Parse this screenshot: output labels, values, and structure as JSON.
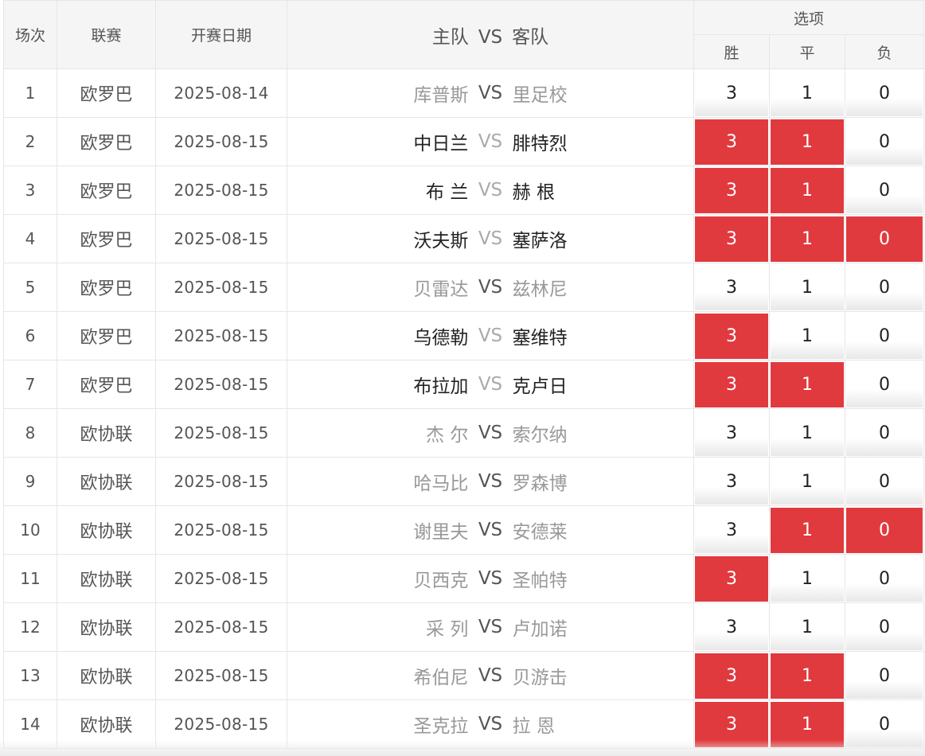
{
  "headers": {
    "num": "场次",
    "league": "联赛",
    "date": "开赛日期",
    "home": "主队",
    "vs": "VS",
    "away": "客队",
    "options": "选项",
    "win": "胜",
    "draw": "平",
    "loss": "负"
  },
  "colors": {
    "selected": "#e03a3e",
    "active_team": "#222222",
    "inactive_team": "#999999"
  },
  "matches": [
    {
      "num": "1",
      "league": "欧罗巴",
      "date": "2025-08-14",
      "home": "库普斯",
      "away": "里足校",
      "active": false,
      "w": "3",
      "d": "1",
      "l": "0",
      "sel": [
        false,
        false,
        false
      ]
    },
    {
      "num": "2",
      "league": "欧罗巴",
      "date": "2025-08-15",
      "home": "中日兰",
      "away": "腓特烈",
      "active": true,
      "w": "3",
      "d": "1",
      "l": "0",
      "sel": [
        true,
        true,
        false
      ]
    },
    {
      "num": "3",
      "league": "欧罗巴",
      "date": "2025-08-15",
      "home": "布 兰",
      "away": "赫 根",
      "active": true,
      "w": "3",
      "d": "1",
      "l": "0",
      "sel": [
        true,
        true,
        false
      ]
    },
    {
      "num": "4",
      "league": "欧罗巴",
      "date": "2025-08-15",
      "home": "沃夫斯",
      "away": "塞萨洛",
      "active": true,
      "w": "3",
      "d": "1",
      "l": "0",
      "sel": [
        true,
        true,
        true
      ]
    },
    {
      "num": "5",
      "league": "欧罗巴",
      "date": "2025-08-15",
      "home": "贝雷达",
      "away": "兹林尼",
      "active": false,
      "w": "3",
      "d": "1",
      "l": "0",
      "sel": [
        false,
        false,
        false
      ]
    },
    {
      "num": "6",
      "league": "欧罗巴",
      "date": "2025-08-15",
      "home": "乌德勒",
      "away": "塞维特",
      "active": true,
      "w": "3",
      "d": "1",
      "l": "0",
      "sel": [
        true,
        false,
        false
      ]
    },
    {
      "num": "7",
      "league": "欧罗巴",
      "date": "2025-08-15",
      "home": "布拉加",
      "away": "克卢日",
      "active": true,
      "w": "3",
      "d": "1",
      "l": "0",
      "sel": [
        true,
        true,
        false
      ]
    },
    {
      "num": "8",
      "league": "欧协联",
      "date": "2025-08-15",
      "home": "杰 尔",
      "away": "索尔纳",
      "active": false,
      "w": "3",
      "d": "1",
      "l": "0",
      "sel": [
        false,
        false,
        false
      ]
    },
    {
      "num": "9",
      "league": "欧协联",
      "date": "2025-08-15",
      "home": "哈马比",
      "away": "罗森博",
      "active": false,
      "w": "3",
      "d": "1",
      "l": "0",
      "sel": [
        false,
        false,
        false
      ]
    },
    {
      "num": "10",
      "league": "欧协联",
      "date": "2025-08-15",
      "home": "谢里夫",
      "away": "安德莱",
      "active": false,
      "w": "3",
      "d": "1",
      "l": "0",
      "sel": [
        false,
        true,
        true
      ]
    },
    {
      "num": "11",
      "league": "欧协联",
      "date": "2025-08-15",
      "home": "贝西克",
      "away": "圣帕特",
      "active": false,
      "w": "3",
      "d": "1",
      "l": "0",
      "sel": [
        true,
        false,
        false
      ]
    },
    {
      "num": "12",
      "league": "欧协联",
      "date": "2025-08-15",
      "home": "采 列",
      "away": "卢加诺",
      "active": false,
      "w": "3",
      "d": "1",
      "l": "0",
      "sel": [
        false,
        false,
        false
      ]
    },
    {
      "num": "13",
      "league": "欧协联",
      "date": "2025-08-15",
      "home": "希伯尼",
      "away": "贝游击",
      "active": false,
      "w": "3",
      "d": "1",
      "l": "0",
      "sel": [
        true,
        true,
        false
      ]
    },
    {
      "num": "14",
      "league": "欧协联",
      "date": "2025-08-15",
      "home": "圣克拉",
      "away": "拉 恩",
      "active": false,
      "w": "3",
      "d": "1",
      "l": "0",
      "sel": [
        true,
        true,
        false
      ]
    }
  ]
}
